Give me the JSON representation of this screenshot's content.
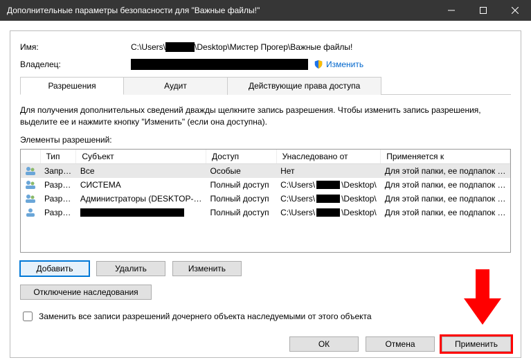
{
  "titlebar": {
    "title": "Дополнительные параметры безопасности  для \"Важные файлы!\""
  },
  "fields": {
    "name_label": "Имя:",
    "name_prefix": "C:\\Users\\",
    "name_suffix": "\\Desktop\\Мистер Прогер\\Важные файлы!",
    "owner_label": "Владелец:",
    "change_link": "Изменить"
  },
  "tabs": {
    "t0": "Разрешения",
    "t1": "Аудит",
    "t2": "Действующие права доступа"
  },
  "description": "Для получения дополнительных сведений дважды щелкните запись разрешения. Чтобы изменить запись разрешения, выделите ее и нажмите кнопку \"Изменить\" (если она доступна).",
  "elements_label": "Элементы разрешений:",
  "columns": {
    "type": "Тип",
    "subject": "Субъект",
    "access": "Доступ",
    "inherited": "Унаследовано от",
    "applies": "Применяется к"
  },
  "rows": {
    "r0": {
      "type": "Запр…",
      "subject": "Все",
      "access": "Особые",
      "inherited": "Нет",
      "applies": "Для этой папки, ее подпапок …"
    },
    "r1": {
      "type": "Разр…",
      "subject": "СИСТЕМА",
      "access": "Полный доступ",
      "inh_pre": "C:\\Users\\",
      "inh_post": "\\Desktop\\",
      "applies": "Для этой папки, ее подпапок …"
    },
    "r2": {
      "type": "Разр…",
      "subject": "Администраторы (DESKTOP-…",
      "access": "Полный доступ",
      "inh_pre": "C:\\Users\\",
      "inh_post": "\\Desktop\\",
      "applies": "Для этой папки, ее подпапок …"
    },
    "r3": {
      "type": "Разр…",
      "subject": "",
      "access": "Полный доступ",
      "inh_pre": "C:\\Users\\",
      "inh_post": "\\Desktop\\",
      "applies": "Для этой папки, ее подпапок …"
    }
  },
  "buttons": {
    "add": "Добавить",
    "remove": "Удалить",
    "edit": "Изменить",
    "disable_inherit": "Отключение наследования",
    "ok": "ОК",
    "cancel": "Отмена",
    "apply": "Применить"
  },
  "checkbox_label": "Заменить все записи разрешений дочернего объекта наследуемыми от этого объекта"
}
